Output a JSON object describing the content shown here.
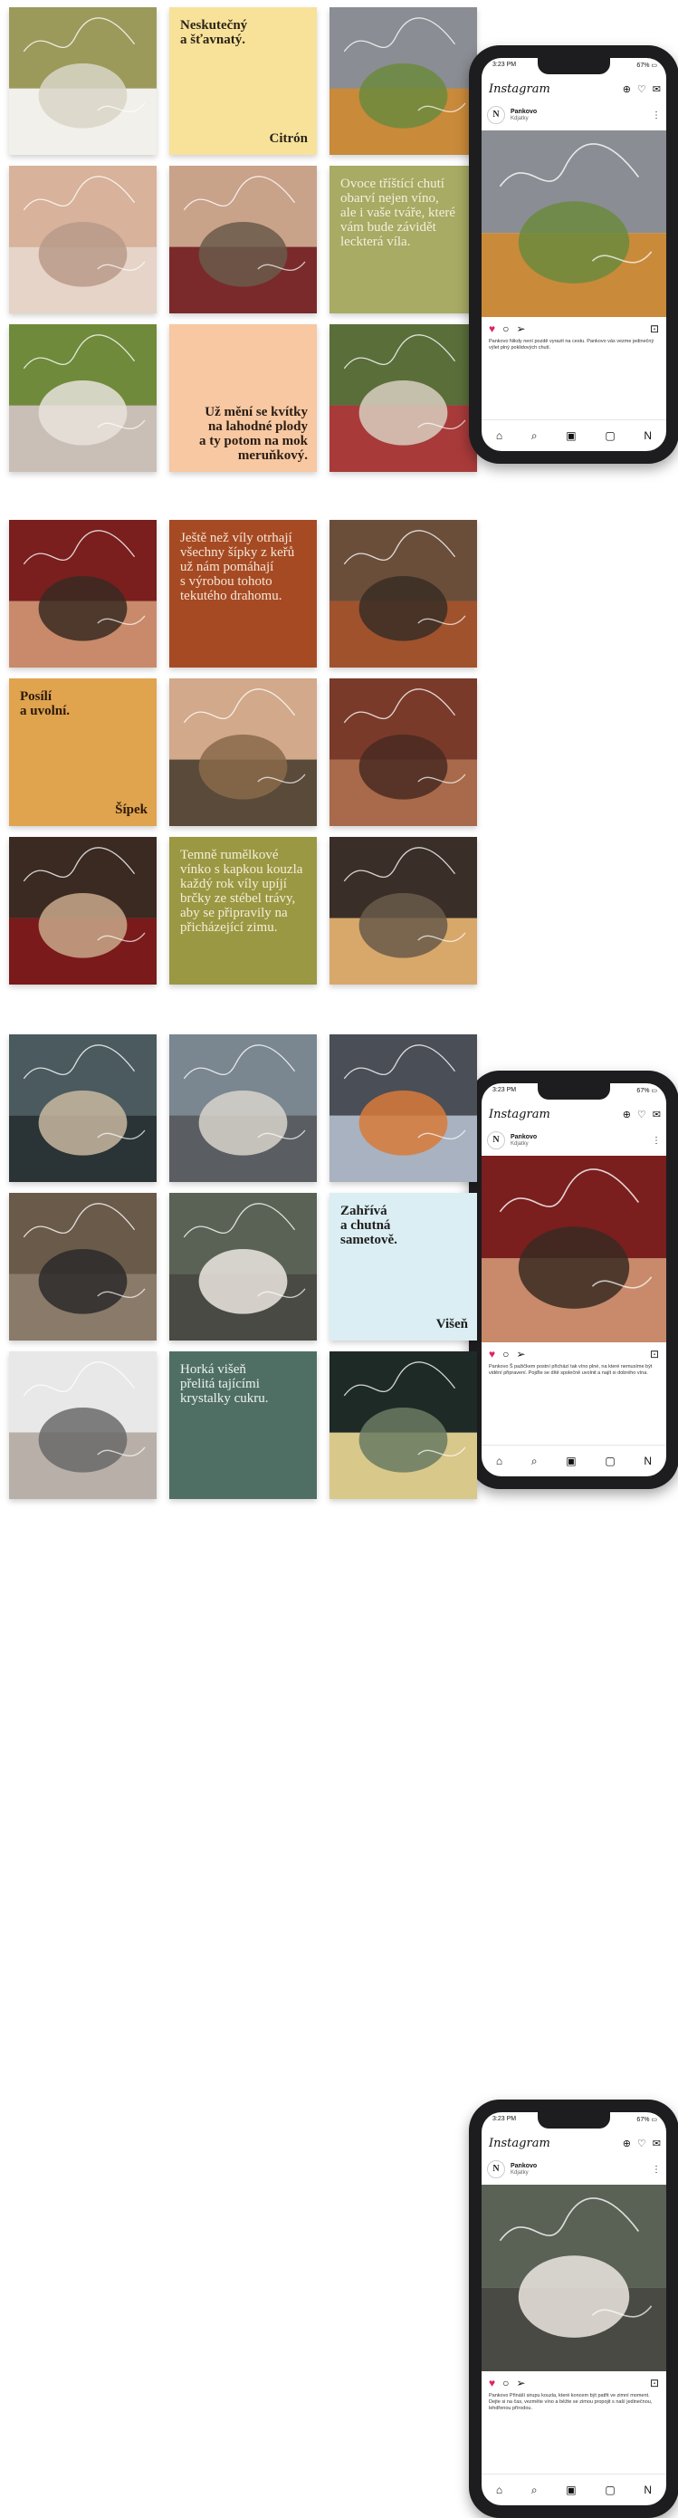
{
  "sections": [
    {
      "tiles": [
        {
          "kind": "photo",
          "icon": "picnic-blanket-photo",
          "colors": [
            "#9c9a5a",
            "#d9d6c8",
            "#f2f0ea"
          ]
        },
        {
          "kind": "text",
          "bg": "#f8e29a",
          "color": "#2a2418",
          "main": "Neskutečný\na šťavnatý.",
          "corner": "Citrón",
          "align": "left"
        },
        {
          "kind": "photo",
          "icon": "mountain-van-photo",
          "colors": [
            "#8a8d93",
            "#6b8a3e",
            "#c98a3a"
          ]
        },
        {
          "kind": "photo",
          "icon": "beach-sunset-photo",
          "colors": [
            "#d8b29a",
            "#b99a8a",
            "#e6d4c8"
          ]
        },
        {
          "kind": "photo",
          "icon": "wine-toast-photo",
          "colors": [
            "#c9a28a",
            "#6a5a4a",
            "#7a2a2a"
          ]
        },
        {
          "kind": "text",
          "bg": "#a7ab63",
          "color": "#f3efdf",
          "main": "Ovoce tříštící chutí\nobarví nejen víno,\nale i vaše tváře, které\nvám bude závidět\nleckterá víla.",
          "corner": "",
          "align": "left",
          "light": true
        },
        {
          "kind": "photo",
          "icon": "blanket-grass-photo",
          "colors": [
            "#6f8a3a",
            "#e8e2dc",
            "#c9bfb6"
          ]
        },
        {
          "kind": "text",
          "bg": "#f7c8a2",
          "color": "#2a1d14",
          "main": "Už mění se kvítky\nna lahodné plody\na ty potom na mok\nmeruňkový.",
          "corner": "",
          "align": "right",
          "bottom": true
        },
        {
          "kind": "photo",
          "icon": "berries-hand-photo",
          "colors": [
            "#5a6e3a",
            "#d8cfc0",
            "#a83a3a"
          ]
        }
      ],
      "phone": {
        "time": "3:23 PM",
        "battery": "67%",
        "logo": "Instagram",
        "account": "Pankovo",
        "sub": "Kdjatky",
        "image": "mountain-van-photo",
        "caption": "Pankovo Nikdy není pozdě vyrazit na cestu. Pankovo vás vezme jedinečný výlet plný poklidových chutí."
      }
    },
    {
      "tiles": [
        {
          "kind": "photo",
          "icon": "woman-red-leaves-photo",
          "colors": [
            "#7a1e1e",
            "#3a2a22",
            "#c88a6a"
          ]
        },
        {
          "kind": "text",
          "bg": "#a64a24",
          "color": "#f5e6d6",
          "main": "Ještě než víly otrhají\nvšechny šípky z keřů\nuž nám pomáhají\ns výrobou tohoto\ntekutého drahomu.",
          "corner": "",
          "align": "left",
          "light": true
        },
        {
          "kind": "photo",
          "icon": "tea-sweater-photo",
          "colors": [
            "#6a4e3a",
            "#3a2e26",
            "#a0522d"
          ]
        },
        {
          "kind": "text",
          "bg": "#e0a34e",
          "color": "#2b1a0c",
          "main": "Posílí\na uvolní.",
          "corner": "Šípek",
          "align": "left"
        },
        {
          "kind": "photo",
          "icon": "umbrella-field-photo",
          "colors": [
            "#d2a98a",
            "#8a6a4a",
            "#5a4a3a"
          ]
        },
        {
          "kind": "photo",
          "icon": "railway-forest-photo",
          "colors": [
            "#7a3a2a",
            "#4a2a22",
            "#a86a4a"
          ]
        },
        {
          "kind": "photo",
          "icon": "wine-book-fire-photo",
          "colors": [
            "#3a2a22",
            "#c8a88a",
            "#7a1a1a"
          ]
        },
        {
          "kind": "text",
          "bg": "#9a9843",
          "color": "#f4efd8",
          "main": "Temně rumělkové\nvínko s kapkou kouzla\nkaždý rok víly upíjí\nbrčky ze stébel trávy,\naby se připravily na\npřicházející zimu.",
          "corner": "",
          "align": "left",
          "light": true
        },
        {
          "kind": "photo",
          "icon": "candles-book-photo",
          "colors": [
            "#3a2e28",
            "#6a5a4a",
            "#d8a86a"
          ]
        }
      ],
      "phone": {
        "time": "3:23 PM",
        "battery": "67%",
        "logo": "Instagram",
        "account": "Pankovo",
        "sub": "Kdjatky",
        "image": "woman-red-leaves-photo",
        "caption": "Pankovo Š pažičkem postní přichází tak víno plné, na které nemusíme být vidění připravení. Pojďte se dítě společně uvolnit a najít si dobrého vína."
      }
    },
    {
      "tiles": [
        {
          "kind": "photo",
          "icon": "logs-forest-photo",
          "colors": [
            "#4a5a5e",
            "#c8b8a0",
            "#2a3436"
          ]
        },
        {
          "kind": "photo",
          "icon": "woman-coat-photo",
          "colors": [
            "#7a8690",
            "#d8d4cc",
            "#5a5e62"
          ]
        },
        {
          "kind": "photo",
          "icon": "fire-glasses-photo",
          "colors": [
            "#4a4e56",
            "#d87a3a",
            "#a8b2c0"
          ]
        },
        {
          "kind": "photo",
          "icon": "woman-grass-photo",
          "colors": [
            "#6a5a4a",
            "#2a2a2a",
            "#8a7a6a"
          ]
        },
        {
          "kind": "photo",
          "icon": "sheep-antlers-photo",
          "colors": [
            "#5a6256",
            "#ece8e0",
            "#4a4a44"
          ]
        },
        {
          "kind": "text",
          "bg": "#dbeef3",
          "color": "#1d1d1d",
          "main": "Zahřívá\na chutná\nsametově.",
          "corner": "Višeň",
          "align": "left"
        },
        {
          "kind": "photo",
          "icon": "snow-mug-photo",
          "colors": [
            "#e8e8e8",
            "#6a6a6a",
            "#b8b0a8"
          ]
        },
        {
          "kind": "text",
          "bg": "#4f6f65",
          "color": "#eef2ee",
          "main": "Horká višeň\npřelitá tajícími\nkrystalky cukru.",
          "corner": "",
          "align": "left",
          "light": true
        },
        {
          "kind": "photo",
          "icon": "christmas-tree-photo",
          "colors": [
            "#1e2a26",
            "#6a7a62",
            "#d8c88a"
          ]
        }
      ],
      "phone": {
        "time": "3:23 PM",
        "battery": "67%",
        "logo": "Instagram",
        "account": "Pankovo",
        "sub": "Kdjatky",
        "image": "sheep-antlers-photo",
        "caption": "Pankovo Přináší sirupu kouzla, které koncem být patřit ve zimní moment. Dejte si na čas, vezměte víno a běžte se zimou propojit s naší jedinečnou, lehdřenou přírodou."
      }
    }
  ]
}
